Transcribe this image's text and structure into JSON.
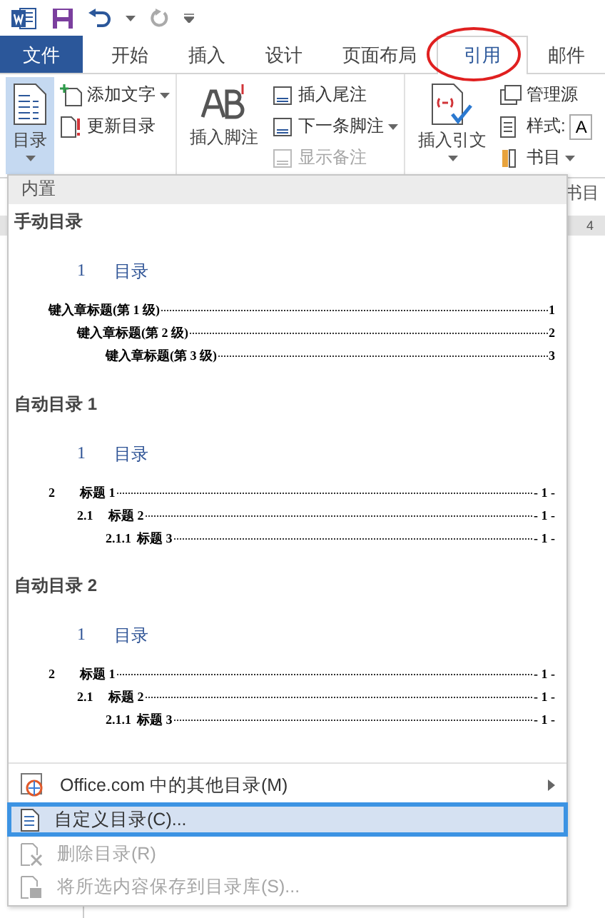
{
  "tabs": [
    {
      "label": "文件",
      "kind": "file",
      "selected": false
    },
    {
      "label": "开始",
      "kind": "tab",
      "selected": false
    },
    {
      "label": "插入",
      "kind": "tab",
      "selected": false
    },
    {
      "label": "设计",
      "kind": "tab",
      "selected": false
    },
    {
      "label": "页面布局",
      "kind": "tab",
      "selected": false
    },
    {
      "label": "引用",
      "kind": "tab",
      "selected": true
    },
    {
      "label": "邮件",
      "kind": "tab",
      "selected": false
    }
  ],
  "ribbon": {
    "toc_button": {
      "label": "目录",
      "selected": true
    },
    "toc_small": [
      {
        "label": "添加文字",
        "dropdown": true
      },
      {
        "label": "更新目录",
        "dropdown": false
      }
    ],
    "footnote_button": {
      "label": "插入脚注"
    },
    "footnote_small": [
      {
        "label": "插入尾注",
        "disabled": false,
        "dropdown": false
      },
      {
        "label": "下一条脚注",
        "disabled": false,
        "dropdown": true
      },
      {
        "label": "显示备注",
        "disabled": true,
        "dropdown": false
      }
    ],
    "citation_button": {
      "label": "插入引文"
    },
    "citation_small": [
      {
        "label": "管理源",
        "kind": "button"
      },
      {
        "label": "样式:",
        "kind": "style",
        "value": "A"
      },
      {
        "label": "书目",
        "kind": "dropdown"
      }
    ],
    "group_label": "书目"
  },
  "ruler": {
    "mark": "4"
  },
  "toc_menu": {
    "section_header": "内置",
    "gallery": [
      {
        "title": "手动目录",
        "preview": {
          "heading_number": "1",
          "heading": "目录",
          "entries": [
            {
              "text": "键入章标题(第 1 级)",
              "page": "1",
              "children": [
                {
                  "text": "键入章标题(第 2 级)",
                  "page": "2",
                  "children": [
                    {
                      "text": "键入章标题(第 3 级)",
                      "page": "3"
                    }
                  ]
                }
              ]
            }
          ]
        }
      },
      {
        "title": "自动目录 1",
        "preview": {
          "heading_number": "1",
          "heading": "目录",
          "entries": [
            {
              "number": "2",
              "text": "标题 1",
              "page": "- 1 -",
              "children": [
                {
                  "number": "2.1",
                  "text": "标题 2",
                  "page": "- 1 -",
                  "children": [
                    {
                      "number": "2.1.1",
                      "text": "标题 3",
                      "page": "- 1 -"
                    }
                  ]
                }
              ]
            }
          ]
        }
      },
      {
        "title": "自动目录 2",
        "preview": {
          "heading_number": "1",
          "heading": "目录",
          "entries": [
            {
              "number": "2",
              "text": "标题 1",
              "page": "- 1 -",
              "children": [
                {
                  "number": "2.1",
                  "text": "标题 2",
                  "page": "- 1 -",
                  "children": [
                    {
                      "number": "2.1.1",
                      "text": "标题 3",
                      "page": "- 1 -"
                    }
                  ]
                }
              ]
            }
          ]
        }
      }
    ],
    "items": [
      {
        "label": "Office.com 中的其他目录(M)",
        "kind": "office",
        "submenu": true,
        "disabled": false,
        "selected": false
      },
      {
        "label": "自定义目录(C)...",
        "kind": "custom",
        "submenu": false,
        "disabled": false,
        "selected": true
      },
      {
        "label": "删除目录(R)",
        "kind": "delete",
        "submenu": false,
        "disabled": true,
        "selected": false
      },
      {
        "label": "将所选内容保存到目录库(S)...",
        "kind": "save",
        "submenu": false,
        "disabled": true,
        "selected": false
      }
    ]
  }
}
